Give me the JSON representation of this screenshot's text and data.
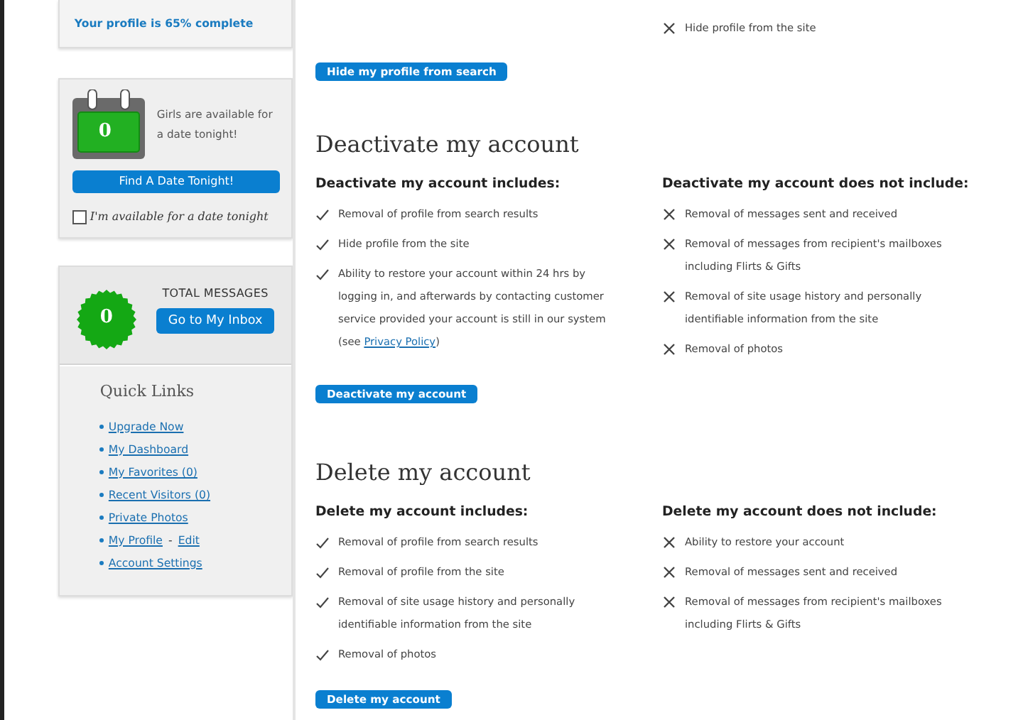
{
  "sidebar": {
    "profile_completion": "Your profile is 65% complete",
    "date_widget": {
      "count": "0",
      "text": "Girls are available for a date tonight!",
      "button": "Find A Date Tonight!",
      "checkbox": {
        "label": "I'm available for a date tonight",
        "checked": false
      }
    },
    "messages": {
      "count": "0",
      "title": "TOTAL MESSAGES",
      "button": "Go to My Inbox"
    },
    "quick_links": {
      "title": "Quick Links",
      "items": [
        {
          "links": [
            "Upgrade Now"
          ]
        },
        {
          "links": [
            "My Dashboard"
          ]
        },
        {
          "links": [
            "My Favorites (0)"
          ]
        },
        {
          "links": [
            "Recent Visitors (0)"
          ]
        },
        {
          "links": [
            "Private Photos"
          ]
        },
        {
          "links": [
            "My Profile",
            "Edit"
          ],
          "separator": "-"
        },
        {
          "links": [
            "Account Settings"
          ]
        }
      ]
    }
  },
  "hide_section": {
    "not_includes": [
      {
        "text": "Hide profile from the site"
      }
    ],
    "button": "Hide my profile from search"
  },
  "sections": [
    {
      "title": "Deactivate my account",
      "includes_heading": "Deactivate my account includes:",
      "includes": [
        {
          "text": "Removal of profile from search results"
        },
        {
          "text": "Hide profile from the site"
        },
        {
          "text": "Ability to restore your account within 24 hrs by logging in, and afterwards by contacting customer service provided your account is still in our system (see ",
          "link": "Privacy Policy",
          "after": ")"
        }
      ],
      "not_includes_heading": "Deactivate my account does not include:",
      "not_includes": [
        {
          "text": "Removal of messages sent and received"
        },
        {
          "text": "Removal of messages from recipient's mailboxes including Flirts & Gifts"
        },
        {
          "text": "Removal of site usage history and personally identifiable information from the site"
        },
        {
          "text": "Removal of photos"
        }
      ],
      "button": "Deactivate my account"
    },
    {
      "title": "Delete my account",
      "includes_heading": "Delete my account includes:",
      "includes": [
        {
          "text": "Removal of profile from search results"
        },
        {
          "text": "Removal of profile from the site"
        },
        {
          "text": "Removal of site usage history and personally identifiable information from the site"
        },
        {
          "text": "Removal of photos"
        }
      ],
      "not_includes_heading": "Delete my account does not include:",
      "not_includes": [
        {
          "text": "Ability to restore your account"
        },
        {
          "text": "Removal of messages sent and received"
        },
        {
          "text": "Removal of messages from recipient's mailboxes including Flirts & Gifts"
        }
      ],
      "button": "Delete my account"
    }
  ]
}
